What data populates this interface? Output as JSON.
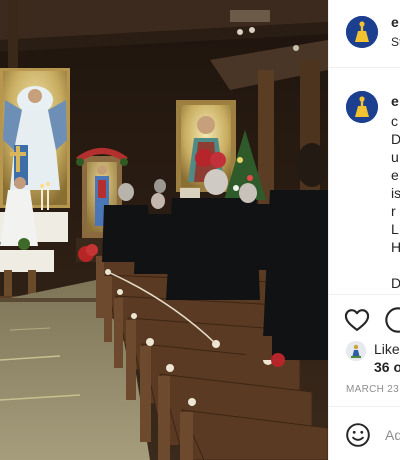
{
  "post": {
    "username": "e",
    "subtitle": "St",
    "caption_username": "e",
    "caption_lines": [
      "c",
      "D",
      "u",
      "e",
      "is",
      "r",
      "L",
      "H",
      "",
      "D"
    ],
    "liked_by_text": "Liked",
    "likes_count_text": "36 o",
    "date": "MARCH 23",
    "comment_placeholder": "Ad"
  },
  "icons": {
    "like": "heart-outline-icon",
    "comment": "speech-bubble-icon",
    "emoji": "smiley-icon"
  },
  "colors": {
    "avatar_bg": "#1c3f8f",
    "avatar_mark": "#f2c230",
    "muted_text": "#8e8e8e",
    "divider": "#efefef"
  }
}
